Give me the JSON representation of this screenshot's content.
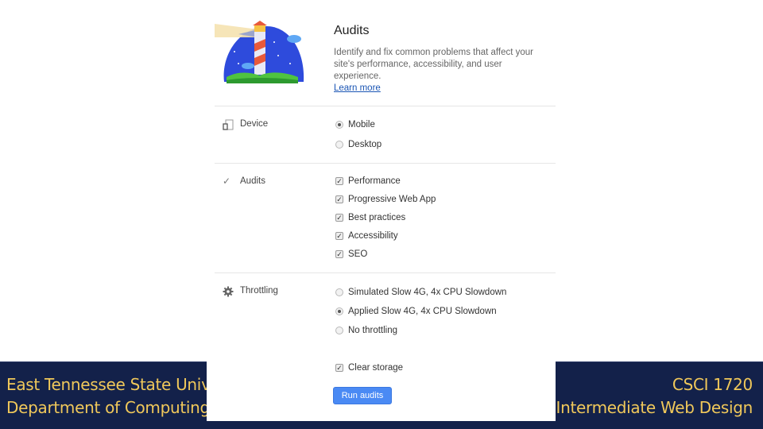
{
  "slide_footer": {
    "left_line1": "East Tennessee State University",
    "left_line2": "Department of Computing",
    "right_line1": "CSCI 1720",
    "right_line2": "Intermediate Web Design",
    "background_color": "#13214a",
    "text_color": "#f0c85a"
  },
  "audits_panel": {
    "logo_icon": "lighthouse-logo",
    "title": "Audits",
    "description": "Identify and fix common problems that affect your site's performance, accessibility, and user experience.",
    "learn_more": "Learn more",
    "sections": {
      "device": {
        "icon": "device-icon",
        "label": "Device",
        "options": [
          {
            "label": "Mobile",
            "type": "radio",
            "checked": true
          },
          {
            "label": "Desktop",
            "type": "radio",
            "checked": false
          }
        ]
      },
      "audits": {
        "icon": "check-icon",
        "label": "Audits",
        "options": [
          {
            "label": "Performance",
            "type": "checkbox",
            "checked": true
          },
          {
            "label": "Progressive Web App",
            "type": "checkbox",
            "checked": true
          },
          {
            "label": "Best practices",
            "type": "checkbox",
            "checked": true
          },
          {
            "label": "Accessibility",
            "type": "checkbox",
            "checked": true
          },
          {
            "label": "SEO",
            "type": "checkbox",
            "checked": true
          }
        ]
      },
      "throttling": {
        "icon": "gear-icon",
        "label": "Throttling",
        "options": [
          {
            "label": "Simulated Slow 4G, 4x CPU Slowdown",
            "type": "radio",
            "checked": false
          },
          {
            "label": "Applied Slow 4G, 4x CPU Slowdown",
            "type": "radio",
            "checked": true
          },
          {
            "label": "No throttling",
            "type": "radio",
            "checked": false
          }
        ]
      }
    },
    "clear_storage": {
      "label": "Clear storage",
      "checked": true
    },
    "run_button": "Run audits",
    "accent_color": "#4a8af4"
  }
}
